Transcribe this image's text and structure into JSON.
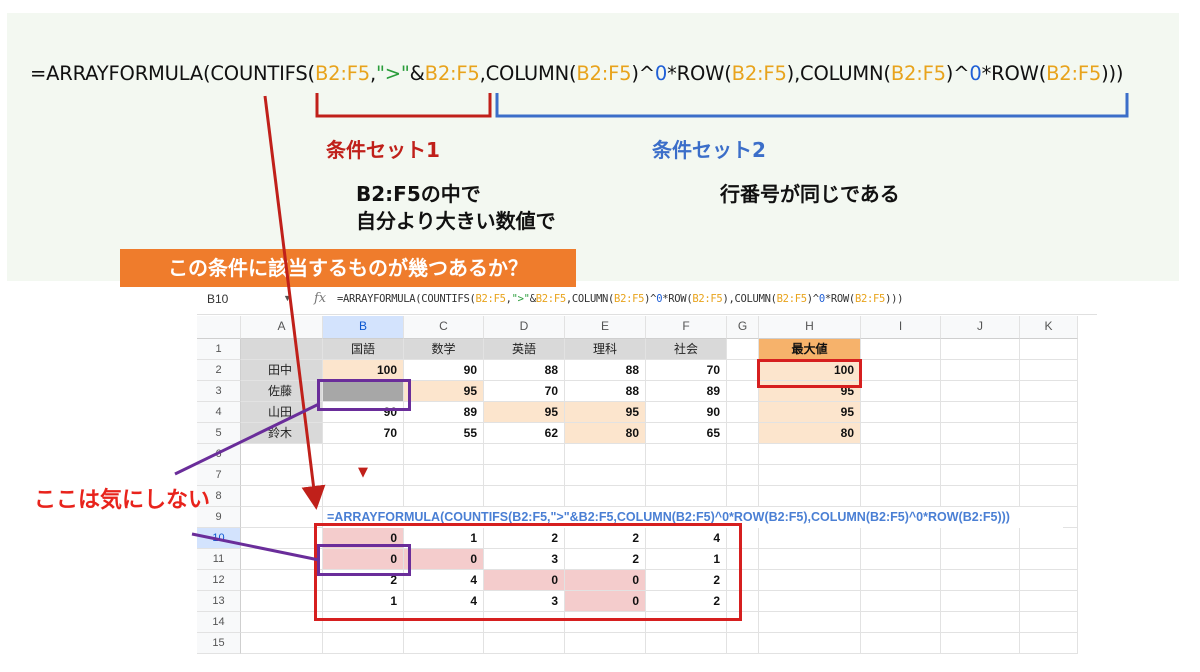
{
  "annotation": {
    "formula_parts": [
      {
        "t": "=ARRAYFORMULA(COUNTIFS(",
        "c": ""
      },
      {
        "t": "B2:F5",
        "c": "ref"
      },
      {
        "t": ",",
        "c": ""
      },
      {
        "t": "\">\"",
        "c": "str"
      },
      {
        "t": "&",
        "c": ""
      },
      {
        "t": "B2:F5",
        "c": "ref"
      },
      {
        "t": ",COLUMN(",
        "c": ""
      },
      {
        "t": "B2:F5",
        "c": "ref"
      },
      {
        "t": ")^",
        "c": ""
      },
      {
        "t": "0",
        "c": "num0"
      },
      {
        "t": "*ROW(",
        "c": ""
      },
      {
        "t": "B2:F5",
        "c": "ref"
      },
      {
        "t": "),COLUMN(",
        "c": ""
      },
      {
        "t": "B2:F5",
        "c": "ref"
      },
      {
        "t": ")^",
        "c": ""
      },
      {
        "t": "0",
        "c": "num0"
      },
      {
        "t": "*ROW(",
        "c": ""
      },
      {
        "t": "B2:F5",
        "c": "ref"
      },
      {
        "t": ")))",
        "c": ""
      }
    ],
    "condition_set_1": "条件セット1",
    "condition_set_2": "条件セット2",
    "desc1_line1": "B2:F5の中で",
    "desc1_line2": "自分より大きい数値で",
    "desc2": "行番号が同じである",
    "question": "この条件に該当するものが幾つあるか？",
    "ignore_label": "ここは気にしない",
    "colors": {
      "red": "#d61f1f",
      "blue": "#3b6ec9",
      "purple": "#6a2d9a",
      "orange": "#ef7c2c",
      "panel": "#f3f8f1"
    }
  },
  "sheet": {
    "name_box": "B10",
    "fx_icon": "fx-icon",
    "formula_parts": [
      {
        "t": "=ARRAYFORMULA(COUNTIFS(",
        "c": ""
      },
      {
        "t": "B2:F5",
        "c": "fb-ref"
      },
      {
        "t": ",",
        "c": ""
      },
      {
        "t": "\">\"",
        "c": "fb-str"
      },
      {
        "t": "&",
        "c": ""
      },
      {
        "t": "B2:F5",
        "c": "fb-ref"
      },
      {
        "t": ",COLUMN(",
        "c": ""
      },
      {
        "t": "B2:F5",
        "c": "fb-ref"
      },
      {
        "t": ")^",
        "c": ""
      },
      {
        "t": "0",
        "c": "fb-num"
      },
      {
        "t": "*ROW(",
        "c": ""
      },
      {
        "t": "B2:F5",
        "c": "fb-ref"
      },
      {
        "t": "),COLUMN(",
        "c": ""
      },
      {
        "t": "B2:F5",
        "c": "fb-ref"
      },
      {
        "t": ")^",
        "c": ""
      },
      {
        "t": "0",
        "c": "fb-num"
      },
      {
        "t": "*ROW(",
        "c": ""
      },
      {
        "t": "B2:F5",
        "c": "fb-ref"
      },
      {
        "t": ")))",
        "c": ""
      }
    ],
    "columns": [
      "A",
      "B",
      "C",
      "D",
      "E",
      "F",
      "G",
      "H",
      "I",
      "J",
      "K"
    ],
    "rows": [
      "1",
      "2",
      "3",
      "4",
      "5",
      "6",
      "7",
      "8",
      "9",
      "10",
      "11",
      "12",
      "13",
      "14",
      "15"
    ],
    "subjects": [
      "国語",
      "数学",
      "英語",
      "理科",
      "社会"
    ],
    "max_header": "最大値",
    "students": [
      {
        "name": "田中",
        "scores": [
          100,
          90,
          88,
          88,
          70
        ],
        "max": 100
      },
      {
        "name": "佐藤",
        "scores": [
          "",
          95,
          70,
          88,
          89
        ],
        "max": 95
      },
      {
        "name": "山田",
        "scores": [
          90,
          89,
          95,
          95,
          90
        ],
        "max": 95
      },
      {
        "name": "鈴木",
        "scores": [
          70,
          55,
          62,
          80,
          65
        ],
        "max": 80
      }
    ],
    "formula_text_in_cell": "=ARRAYFORMULA(COUNTIFS(B2:F5,\">\"&B2:F5,COLUMN(B2:F5)^0*ROW(B2:F5),COLUMN(B2:F5)^0*ROW(B2:F5)))",
    "results": [
      [
        0,
        1,
        2,
        2,
        4
      ],
      [
        0,
        0,
        3,
        2,
        1
      ],
      [
        2,
        4,
        0,
        0,
        2
      ],
      [
        1,
        4,
        3,
        0,
        2
      ]
    ]
  }
}
